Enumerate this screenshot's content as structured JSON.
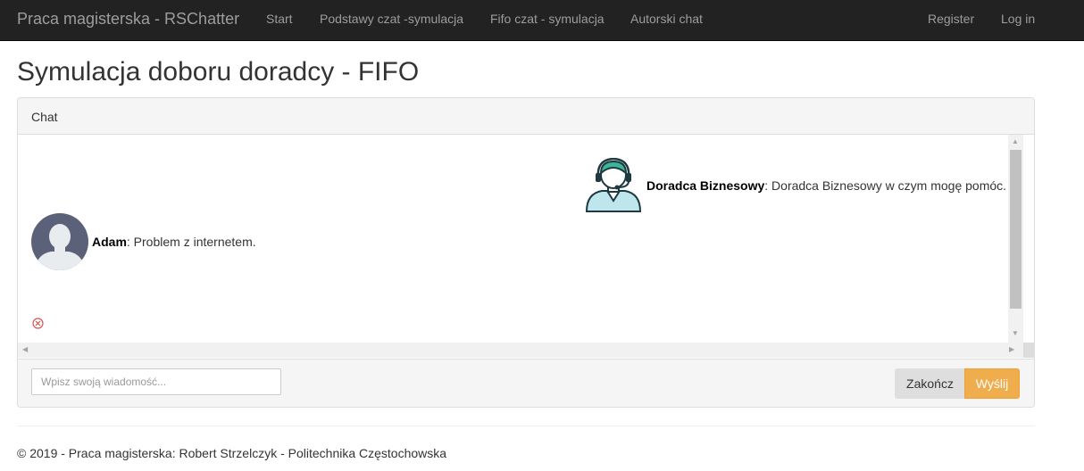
{
  "navbar": {
    "brand": "Praca magisterska - RSChatter",
    "links": [
      "Start",
      "Podstawy czat -symulacja",
      "Fifo czat - symulacja",
      "Autorski chat"
    ],
    "register": "Register",
    "login": "Log in"
  },
  "page": {
    "title": "Symulacja doboru doradcy - FIFO"
  },
  "chat": {
    "heading": "Chat",
    "messages": [
      {
        "sender": "Doradca Biznesowy",
        "text": ": Doradca Biznesowy w czym mogę pomóc.",
        "avatar": "headset-agent-icon"
      },
      {
        "sender": "Adam",
        "text": ": Problem z internetem.",
        "avatar": "user-avatar-icon"
      }
    ],
    "input_placeholder": "Wpisz swoją wiadomość...",
    "end_label": "Zakończ",
    "send_label": "Wyślij"
  },
  "footer": {
    "text": "© 2019 - Praca magisterska: Robert Strzelczyk - Politechnika Częstochowska"
  },
  "colors": {
    "navbar_bg": "#222222",
    "accent_send": "#f0ad4e",
    "error": "#d9534f"
  }
}
